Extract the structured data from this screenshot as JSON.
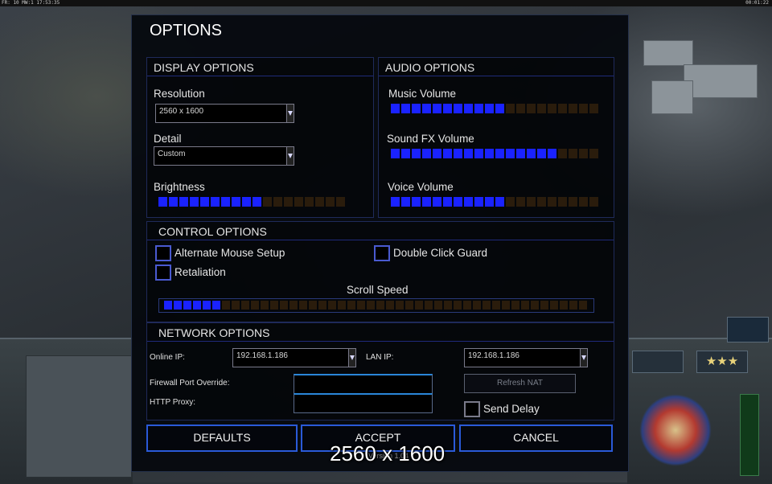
{
  "topbar": {
    "left_text": "FR: 10  MW:1 17:53:35",
    "right_text": "00:01:22"
  },
  "panel": {
    "title": "OPTIONS"
  },
  "display": {
    "header": "DISPLAY OPTIONS",
    "resolution_label": "Resolution",
    "resolution_value": "2560 x 1600",
    "detail_label": "Detail",
    "detail_value": "Custom",
    "brightness_label": "Brightness",
    "brightness_level": 0.56,
    "brightness_segments": 18
  },
  "audio": {
    "header": "AUDIO OPTIONS",
    "music_label": "Music Volume",
    "music_level": 0.55,
    "sfx_label": "Sound FX Volume",
    "sfx_level": 0.82,
    "voice_label": "Voice Volume",
    "voice_level": 0.55,
    "segments": 20
  },
  "control": {
    "header": "CONTROL OPTIONS",
    "alt_mouse_label": "Alternate Mouse Setup",
    "alt_mouse_checked": false,
    "double_click_label": "Double Click Guard",
    "double_click_checked": false,
    "retaliation_label": "Retaliation",
    "retaliation_checked": false,
    "scroll_label": "Scroll Speed",
    "scroll_level": 0.14,
    "scroll_segments": 44
  },
  "network": {
    "header": "NETWORK OPTIONS",
    "online_ip_label": "Online IP:",
    "online_ip_value": "192.168.1.186",
    "lan_ip_label": "LAN IP:",
    "lan_ip_value": "192.168.1.186",
    "firewall_label": "Firewall Port Override:",
    "firewall_value": "",
    "proxy_label": "HTTP Proxy:",
    "proxy_value": "",
    "refresh_nat_label": "Refresh NAT",
    "send_delay_label": "Send Delay",
    "send_delay_checked": false
  },
  "buttons": {
    "defaults": "DEFAULTS",
    "accept": "ACCEPT",
    "cancel": "CANCEL"
  },
  "version": "Version 1.04",
  "caption": "2560 x 1600",
  "colors": {
    "accent": "#2a5ad8",
    "slider_on": "#1a22ff",
    "slider_off": "#2a1c0c"
  }
}
